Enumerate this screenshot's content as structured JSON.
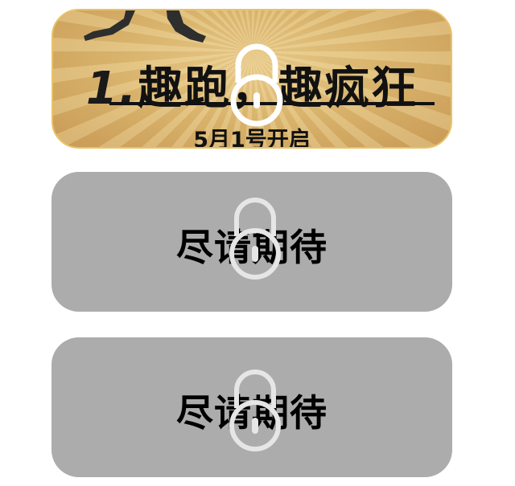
{
  "cards": [
    {
      "headline_num": "1.",
      "headline_text": "趣跑，趣疯狂",
      "subline": "5月1号开启",
      "status": "locked",
      "accent": "#e8c266"
    },
    {
      "label": "尽请期待",
      "status": "locked",
      "color": "#acacac"
    },
    {
      "label": "尽请期待",
      "status": "locked",
      "color": "#acacac"
    }
  ],
  "icons": {
    "lock": "lock-icon",
    "runner": "runner-silhouette"
  }
}
